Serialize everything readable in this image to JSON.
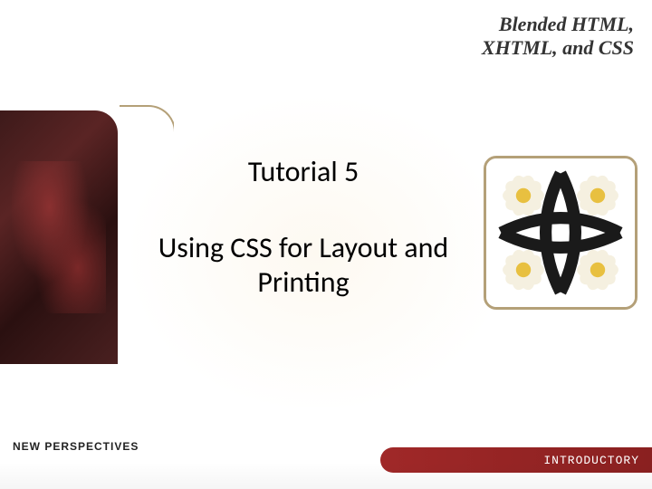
{
  "header": {
    "book_title_line1": "Blended HTML,",
    "book_title_line2": "XHTML, and CSS"
  },
  "main": {
    "tutorial_label": "Tutorial 5",
    "tutorial_title": "Using CSS for Layout and Printing"
  },
  "footer": {
    "series_label": "NEW PERSPECTIVES",
    "level_label": "INTRODUCTORY"
  }
}
